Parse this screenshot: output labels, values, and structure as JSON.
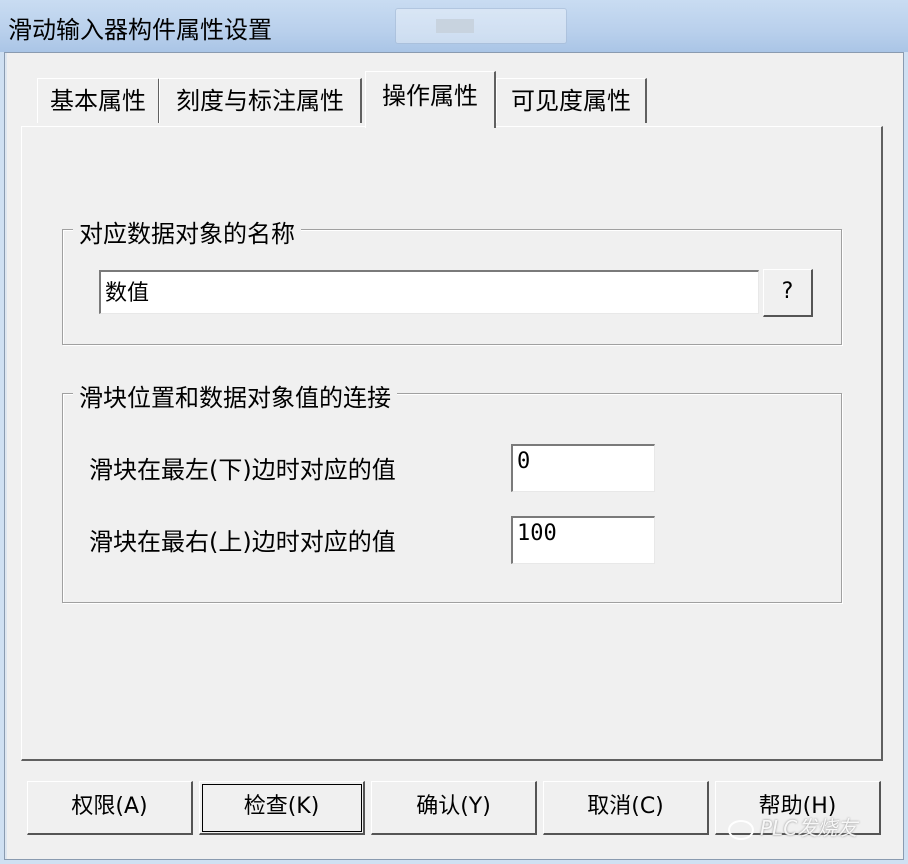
{
  "window": {
    "title": "滑动输入器构件属性设置"
  },
  "tabs": [
    {
      "label": "基本属性"
    },
    {
      "label": "刻度与标注属性"
    },
    {
      "label": "操作属性",
      "active": true
    },
    {
      "label": "可见度属性"
    }
  ],
  "data_object_group": {
    "label": "对应数据对象的名称",
    "value": "数值",
    "browse_label": "?"
  },
  "slider_link_group": {
    "label": "滑块位置和数据对象值的连接",
    "min_label": "滑块在最左(下)边时对应的值",
    "min_value": "0",
    "max_label": "滑块在最右(上)边时对应的值",
    "max_value": "100"
  },
  "buttons": {
    "permission": "权限(A)",
    "check": "检查(K)",
    "ok": "确认(Y)",
    "cancel": "取消(C)",
    "help": "帮助(H)"
  },
  "watermark": "PLC发烧友"
}
